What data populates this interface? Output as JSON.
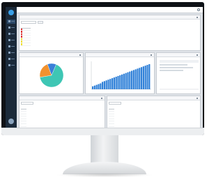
{
  "app": {
    "title": "",
    "nav_items": [
      {
        "icon": "home-icon"
      },
      {
        "icon": "grid-icon"
      },
      {
        "icon": "list-icon"
      },
      {
        "icon": "chart-icon"
      },
      {
        "icon": "tool-icon"
      },
      {
        "icon": "calendar-icon"
      },
      {
        "icon": "user-icon"
      },
      {
        "icon": "settings-icon"
      }
    ]
  },
  "top_panel": {
    "title": "",
    "columns": [
      "",
      "",
      "",
      "",
      "",
      "",
      ""
    ],
    "rows": [
      {
        "status": "red",
        "cells": [
          "",
          "",
          "",
          "",
          "",
          "",
          ""
        ]
      },
      {
        "status": "red",
        "cells": [
          "",
          "",
          "",
          "",
          "",
          "",
          ""
        ]
      },
      {
        "status": "red",
        "cells": [
          "",
          "",
          "",
          "",
          "",
          "",
          ""
        ]
      },
      {
        "status": "red",
        "cells": [
          "",
          "",
          "",
          "",
          "",
          "",
          ""
        ]
      },
      {
        "status": "yellow",
        "cells": [
          "",
          "",
          "",
          "",
          "",
          "",
          ""
        ]
      },
      {
        "status": "yellow",
        "cells": [
          "",
          "",
          "",
          "",
          "",
          "",
          ""
        ]
      },
      {
        "status": "yellow",
        "cells": [
          "",
          "",
          "",
          "",
          "",
          "",
          ""
        ]
      }
    ]
  },
  "pie_panel": {
    "title": ""
  },
  "bar_panel": {
    "title": ""
  },
  "third_panel": {
    "title": ""
  },
  "bottom_left_panel": {
    "title": "",
    "columns": [
      "",
      "",
      "",
      ""
    ],
    "row_count": 10
  },
  "bottom_right_panel": {
    "title": "",
    "columns": [
      "",
      "",
      "",
      ""
    ],
    "row_count": 10
  },
  "colors": {
    "sidebar": "#1b2a3a",
    "accent": "#3aa0e8",
    "critical": "#e02a2a",
    "warning": "#f2e12a",
    "pie_teal": "#3ec6b4",
    "pie_orange": "#f2922e",
    "pie_blue": "#3a7fd8",
    "bar_blue": "#2f80d8"
  },
  "chart_data": [
    {
      "type": "pie",
      "title": "",
      "categories": [
        "",
        "",
        ""
      ],
      "values": [
        66,
        22,
        12
      ],
      "colors": [
        "#3ec6b4",
        "#f2922e",
        "#3a7fd8"
      ]
    },
    {
      "type": "bar",
      "title": "",
      "xlabel": "",
      "ylabel": "",
      "values": [
        4,
        5,
        6,
        7,
        8,
        10,
        11,
        12,
        13,
        14,
        15,
        16,
        17,
        18,
        19,
        20,
        21,
        22,
        23,
        24,
        25,
        26,
        27,
        28,
        29,
        30,
        31,
        32,
        33,
        34
      ]
    }
  ]
}
